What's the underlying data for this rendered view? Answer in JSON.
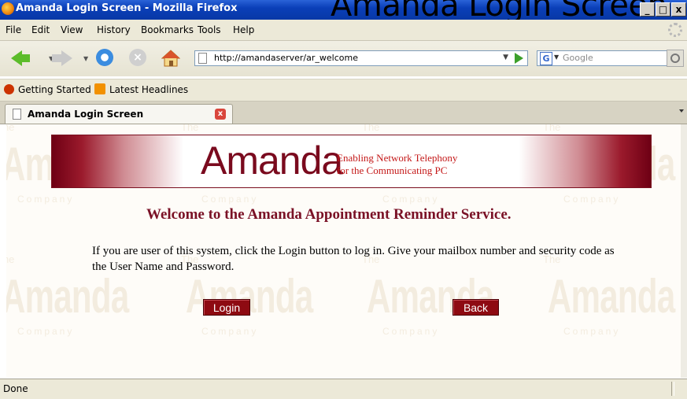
{
  "browser": {
    "window_title": "Amanda Login Screen - Mozilla Firefox",
    "overlay_title": "Amanda Login Screen",
    "window_controls": [
      "_",
      "□",
      "x"
    ],
    "menu": [
      "File",
      "Edit",
      "View",
      "History",
      "Bookmarks",
      "Tools",
      "Help"
    ],
    "url": "http://amandaserver/ar_welcome",
    "search_placeholder": "Google",
    "bookmarks": [
      "Getting Started",
      "Latest Headlines"
    ],
    "tab_label": "Amanda Login Screen",
    "status": "Done"
  },
  "page": {
    "banner_title": "Amanda",
    "tagline_line1": "Enabling Network Telephony",
    "tagline_line2": "for the Communicating PC",
    "heading": "Welcome to the Amanda Appointment Reminder Service.",
    "intro": "If you are user of this system, click the Login button to log in. Give your mailbox number and security code as the User Name and Password.",
    "login_label": "Login",
    "back_label": "Back",
    "watermark_top": "The",
    "watermark_main": "Amanda",
    "watermark_bottom": "Company"
  },
  "colors": {
    "accent": "#7a1126",
    "button": "#8e0a12",
    "titlebar": "#0a3fb8"
  },
  "icons": [
    "firefox-icon",
    "back-icon",
    "forward-icon",
    "reload-icon",
    "stop-icon",
    "home-icon",
    "page-icon",
    "go-icon",
    "google-icon",
    "search-icon",
    "bookmark-icon",
    "rss-icon",
    "close-tab-icon"
  ]
}
